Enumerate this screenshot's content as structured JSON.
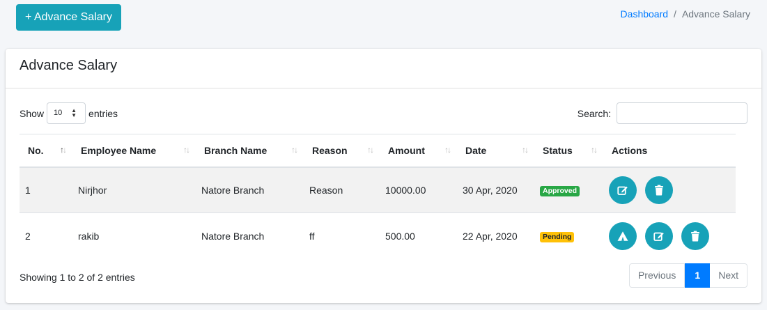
{
  "header": {
    "add_button_label": "+ Advance Salary",
    "breadcrumb": {
      "home": "Dashboard",
      "separator": "/",
      "current": "Advance Salary"
    }
  },
  "card": {
    "title": "Advance Salary",
    "length": {
      "show_label": "Show",
      "value": "10",
      "entries_label": "entries"
    },
    "search_label": "Search:",
    "columns": [
      "No.",
      "Employee Name",
      "Branch Name",
      "Reason",
      "Amount",
      "Date",
      "Status",
      "Actions"
    ],
    "rows": [
      {
        "no": "1",
        "employee": "Nirjhor",
        "branch": "Natore Branch",
        "reason": "Reason",
        "amount": "10000.00",
        "date": "30 Apr, 2020",
        "status": "Approved"
      },
      {
        "no": "2",
        "employee": "rakib",
        "branch": "Natore Branch",
        "reason": "ff",
        "amount": "500.00",
        "date": "22 Apr, 2020",
        "status": "Pending"
      }
    ],
    "info": "Showing 1 to 2 of 2 entries",
    "pagination": {
      "previous": "Previous",
      "current": "1",
      "next": "Next"
    }
  },
  "colors": {
    "accent": "#17a2b8",
    "approved": "#28a745",
    "pending": "#ffc107",
    "link": "#007bff"
  },
  "icons": {
    "edit": "edit-icon",
    "delete": "trash-icon",
    "approve": "approve-icon",
    "sort": "sort-icon",
    "select_caret": "chevron-updown-icon"
  }
}
